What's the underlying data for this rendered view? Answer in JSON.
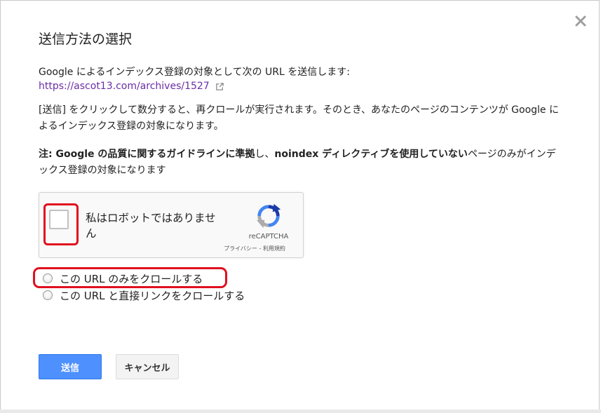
{
  "dialog": {
    "title": "送信方法の選択",
    "intro": "Google によるインデックス登録の対象として次の URL を送信します:",
    "url": "https://ascot13.com/archives/1527",
    "description": "[送信] をクリックして数分すると、再クロールが実行されます。そのとき、あなたのページのコンテンツが Google によるインデックス登録の対象になります。",
    "note": {
      "label": "注: ",
      "guideline": "Google の品質に関するガイドラインに準拠",
      "mid": "し、",
      "noindex": "noindex ディレクティブを使用していない",
      "tail": "ページのみがインデックス登録の対象になります"
    }
  },
  "recaptcha": {
    "label": "私はロボットではありません",
    "brand": "reCAPTCHA",
    "privacy": "プライバシー",
    "separator": " - ",
    "terms": "利用規約"
  },
  "options": [
    {
      "label": "この URL のみをクロールする"
    },
    {
      "label": "この URL と直接リンクをクロールする"
    }
  ],
  "buttons": {
    "submit": "送信",
    "cancel": "キャンセル"
  },
  "colors": {
    "link": "#6a2ea6",
    "primary": "#4d90fe",
    "highlight": "#e0101e"
  },
  "icons": {
    "close": "close-icon",
    "external": "external-link-icon",
    "recaptcha": "recaptcha-logo-icon"
  }
}
